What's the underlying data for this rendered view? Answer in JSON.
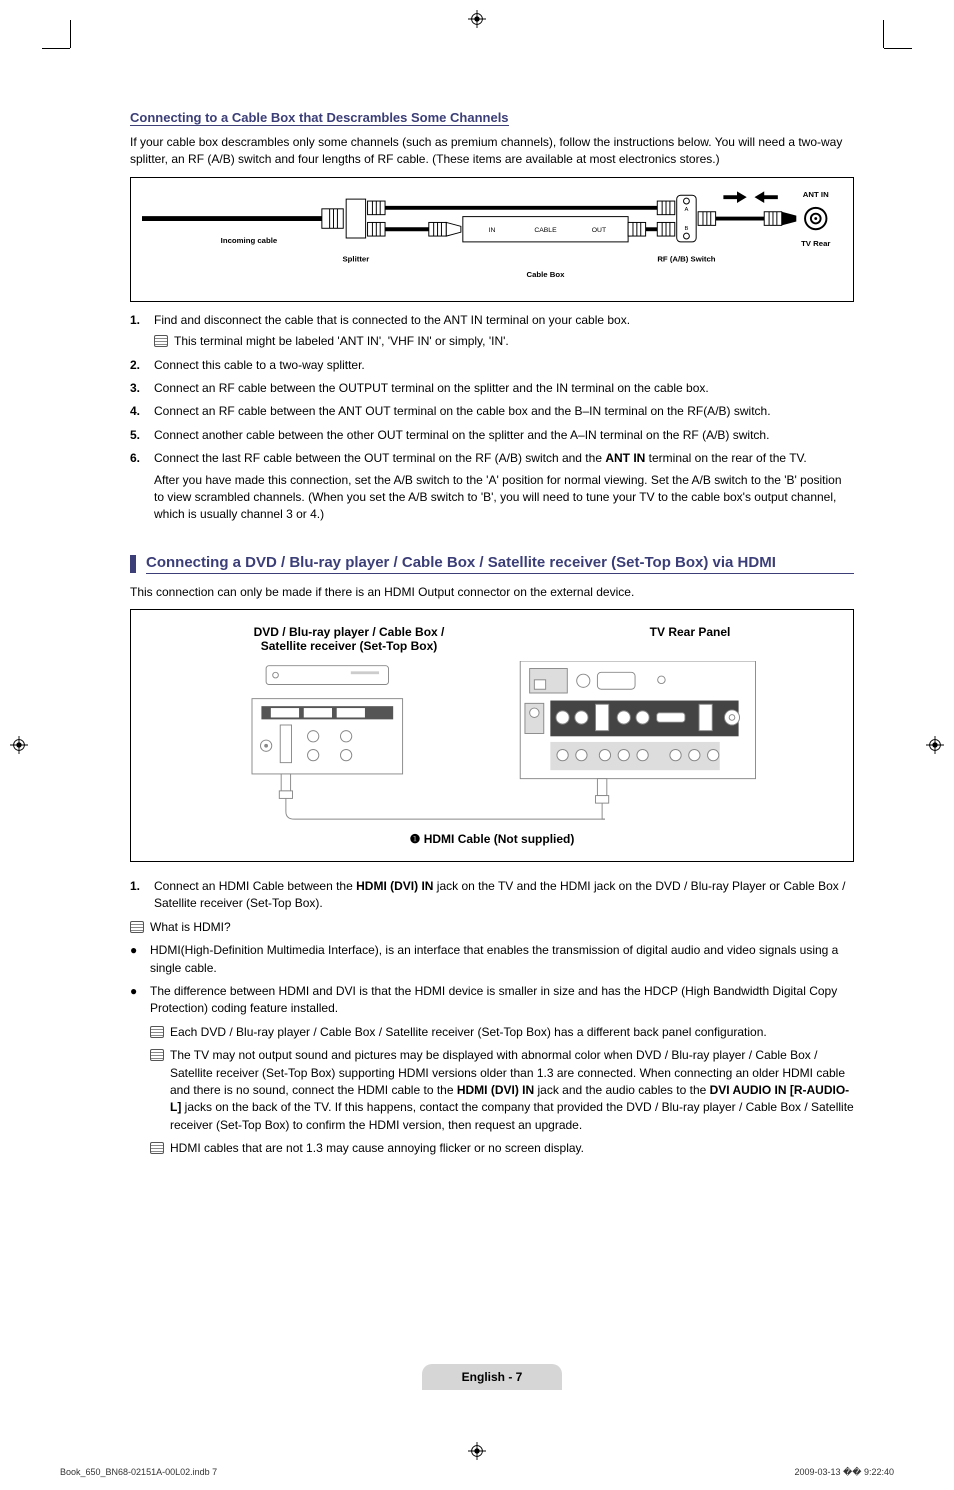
{
  "section1": {
    "title": "Connecting to a Cable Box that Descrambles Some Channels",
    "intro": "If your cable box descrambles only some channels (such as premium channels), follow the instructions below. You will need a two-way splitter, an RF (A/B) switch and four lengths of RF cable. (These items are available at most electronics stores.)",
    "diagram": {
      "incoming_cable": "Incoming cable",
      "splitter": "Splitter",
      "cable_box": "Cable Box",
      "rf_switch": "RF (A/B) Switch",
      "ant_in": "ANT IN",
      "tv_rear": "TV Rear",
      "in": "IN",
      "cable": "CABLE",
      "out": "OUT",
      "a": "A",
      "b": "B"
    },
    "steps": [
      {
        "num": "1.",
        "text": "Find and disconnect the cable that is connected to the ANT IN terminal on your cable box.",
        "note": "This terminal might be labeled 'ANT IN', 'VHF IN' or simply, 'IN'."
      },
      {
        "num": "2.",
        "text": "Connect this cable to a two-way splitter."
      },
      {
        "num": "3.",
        "text": "Connect an RF cable between the OUTPUT terminal on the splitter and the IN terminal on the cable box."
      },
      {
        "num": "4.",
        "text": "Connect an RF cable between the ANT OUT terminal on the cable box and the B–IN terminal on the RF(A/B) switch."
      },
      {
        "num": "5.",
        "text": "Connect another cable between the other OUT terminal on the splitter and the A–IN terminal on the RF (A/B) switch."
      },
      {
        "num": "6.",
        "text_pre": "Connect the last RF cable between the OUT terminal on the RF (A/B) switch and the ",
        "text_bold": "ANT IN",
        "text_post": " terminal on the rear of the TV.",
        "after": "After you have made this connection, set the A/B switch to the 'A' position for normal viewing. Set the A/B switch to the 'B' position to view scrambled channels. (When you set the A/B switch to 'B', you will need to tune your TV to the cable box's output channel, which is usually channel 3 or 4.)"
      }
    ]
  },
  "section2": {
    "heading": "Connecting a DVD / Blu-ray player / Cable Box / Satellite receiver (Set-Top Box) via HDMI",
    "intro": "This connection can only be made if there is an HDMI Output connector on the external device.",
    "diagram": {
      "left_label_1": "DVD / Blu-ray player / Cable Box /",
      "left_label_2": "Satellite receiver (Set-Top Box)",
      "right_label": "TV Rear Panel",
      "cable_label_pre": "❶ ",
      "cable_label": "HDMI Cable (Not supplied)"
    },
    "step1": {
      "num": "1.",
      "pre": "Connect an HDMI Cable between the ",
      "b1": "HDMI (DVI) IN",
      "mid": " jack on the TV and the HDMI jack on the DVD / Blu-ray Player or Cable Box / Satellite receiver (Set-Top Box)."
    },
    "what_is_hdmi": "What is HDMI?",
    "bullet1": "HDMI(High-Definition Multimedia Interface), is an interface that enables the transmission of digital audio and video signals using a single cable.",
    "bullet2": "The difference between HDMI and DVI is that the HDMI device is smaller in size and has the HDCP (High Bandwidth Digital Copy Protection) coding feature installed.",
    "nested1": "Each DVD / Blu-ray player / Cable Box / Satellite receiver (Set-Top Box) has a different back panel configuration.",
    "nested2": {
      "pre": "The TV may not output sound and pictures may be displayed with abnormal color when DVD / Blu-ray player / Cable Box / Satellite receiver (Set-Top Box) supporting HDMI versions older than 1.3 are connected. When connecting an older HDMI cable and there is no sound, connect the HDMI cable to the ",
      "b1": "HDMI (DVI) IN",
      "mid": " jack and the audio cables to the ",
      "b2": "DVI AUDIO IN [R-AUDIO-L]",
      "post": " jacks on the back of the TV. If this happens, contact the company that provided the DVD / Blu-ray player / Cable Box / Satellite receiver (Set-Top Box) to confirm the HDMI version, then request an upgrade."
    },
    "nested3": "HDMI cables that are not 1.3 may cause annoying flicker or no screen display."
  },
  "footer": "English - 7",
  "print_meta_left": "Book_650_BN68-02151A-00L02.indb   7",
  "print_meta_right": "2009-03-13   �� 9:22:40"
}
